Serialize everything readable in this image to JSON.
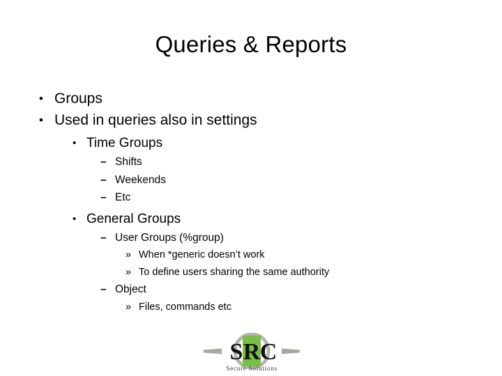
{
  "slide": {
    "title": "Queries & Reports",
    "background_color": "#ffffff",
    "text_color": "#000000"
  },
  "outline": {
    "bullet_marks": {
      "level1": "•",
      "level2": "•",
      "level3": "–",
      "level4": "»"
    },
    "items": [
      {
        "level": 1,
        "mark": "•",
        "text": "Groups"
      },
      {
        "level": 1,
        "mark": "•",
        "text": "Used in queries also in settings"
      },
      {
        "level": 2,
        "mark": "•",
        "text": "Time Groups"
      },
      {
        "level": 3,
        "mark": "–",
        "text": "Shifts"
      },
      {
        "level": 3,
        "mark": "–",
        "text": "Weekends"
      },
      {
        "level": 3,
        "mark": "–",
        "text": "Etc"
      },
      {
        "level": 2,
        "mark": "•",
        "text": "General Groups"
      },
      {
        "level": 3,
        "mark": "–",
        "text": "User Groups (%group)"
      },
      {
        "level": 4,
        "mark": "»",
        "text": "When *generic doesn’t work"
      },
      {
        "level": 4,
        "mark": "»",
        "text": "To define users sharing the same authority"
      },
      {
        "level": 3,
        "mark": "–",
        "text": "Object"
      },
      {
        "level": 4,
        "mark": "»",
        "text": "Files, commands etc"
      }
    ]
  },
  "logo": {
    "name": "src-secure-solutions-logo",
    "letters": "SRC",
    "letter_s": "S",
    "letter_r": "R",
    "letter_c": "C",
    "tagline": "Secure Solutions",
    "accent_color": "#77c043",
    "ring_color": "#b5b5b0",
    "bar_color": "#a8a8a2",
    "letter_color": "#111111",
    "tagline_color": "#3a3a36"
  }
}
